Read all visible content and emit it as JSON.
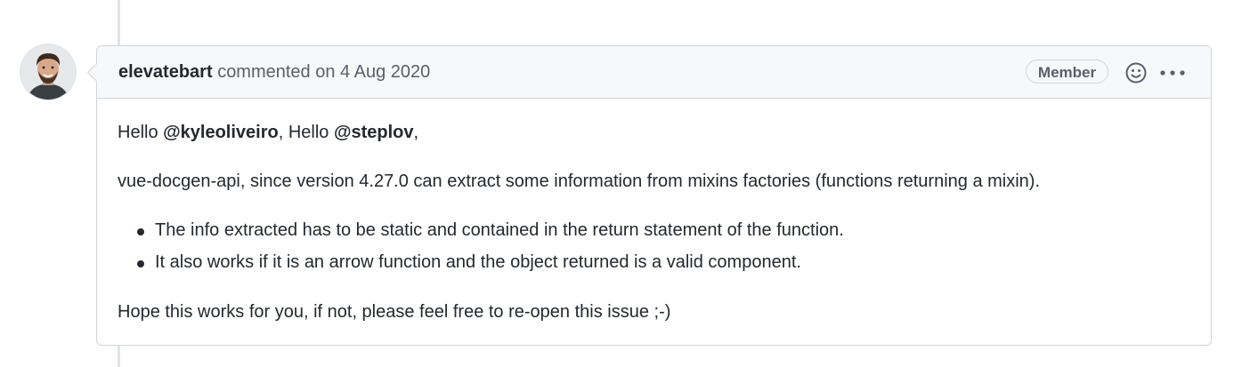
{
  "comment": {
    "author": "elevatebart",
    "action_text": "commented on",
    "date": "4 Aug 2020",
    "badge": "Member",
    "header_icons": [
      "smiley-icon",
      "kebab-horizontal-icon"
    ],
    "body": {
      "greeting": {
        "part1": "Hello ",
        "mention1": "@kyleoliveiro",
        "part2": ", Hello ",
        "mention2": "@steplov",
        "part3": ","
      },
      "paragraph1": "vue-docgen-api, since version 4.27.0 can extract some information from mixins factories (functions returning a mixin).",
      "list_items": [
        "The info extracted has to be static and contained in the return statement of the function.",
        "It also works if it is an arrow function and the object returned is a valid component."
      ],
      "closing": "Hope this works for you, if not, please feel free to re-open this issue ;-)"
    }
  },
  "colors": {
    "header_bg": "#f6f8fa",
    "border": "#d1d5da",
    "text": "#24292e",
    "muted": "#586069"
  }
}
